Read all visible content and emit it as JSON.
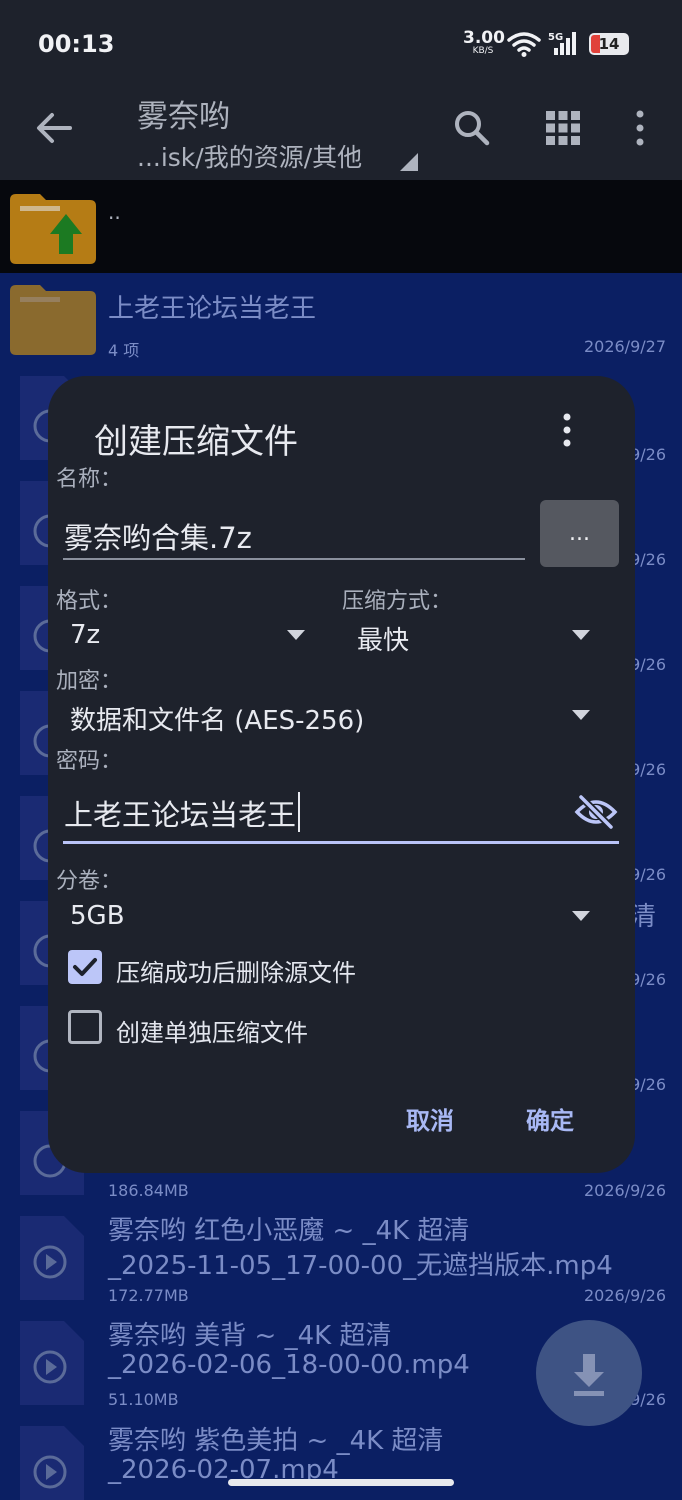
{
  "status_bar": {
    "time": "00:13",
    "net_rate": "3.00",
    "net_unit": "KB/S",
    "cell_label": "5G",
    "battery": "14"
  },
  "header": {
    "title": "雾奈哟",
    "path": "...isk/我的资源/其他"
  },
  "parent_row": {
    "label": ".."
  },
  "folder": {
    "name": "上老王论坛当老王",
    "count": "4 项",
    "date": "2026/9/27"
  },
  "background_dates": [
    "9/26",
    "9/26",
    "9/26",
    "9/26",
    "9/26",
    "9/26",
    "9/26"
  ],
  "background_fragment": "清",
  "files": [
    {
      "size": "186.84MB",
      "date": "2026/9/26"
    },
    {
      "line1": "雾奈哟 红色小恶魔 ~ _4K 超清",
      "line2": "_2025-11-05_17-00-00_无遮挡版本.mp4",
      "size": "172.77MB",
      "date": "2026/9/26"
    },
    {
      "line1": "雾奈哟 美背 ~ _4K 超清",
      "line2": "_2026-02-06_18-00-00.mp4",
      "size": "51.10MB",
      "date": "9/26"
    },
    {
      "line1": "雾奈哟 紫色美拍 ~ _4K 超清",
      "line2": "_2026-02-07.mp4"
    }
  ],
  "dialog": {
    "title": "创建压缩文件",
    "name_label": "名称：",
    "name_value": "雾奈哟合集.7z",
    "browse_label": "...",
    "format_label": "格式：",
    "format_value": "7z",
    "method_label": "压缩方式：",
    "method_value": "最快",
    "encrypt_label": "加密：",
    "encrypt_value": "数据和文件名 (AES-256)",
    "password_label": "密码：",
    "password_value": "上老王论坛当老王",
    "split_label": "分卷：",
    "split_value": "5GB",
    "delete_source_label": "压缩成功后删除源文件",
    "delete_source_checked": true,
    "separate_label": "创建单独压缩文件",
    "separate_checked": false,
    "cancel_label": "取消",
    "ok_label": "确定"
  },
  "colors": {
    "accent": "#bcc6f8",
    "selection": "#0b1f63",
    "dialog_bg": "#1e222c"
  }
}
